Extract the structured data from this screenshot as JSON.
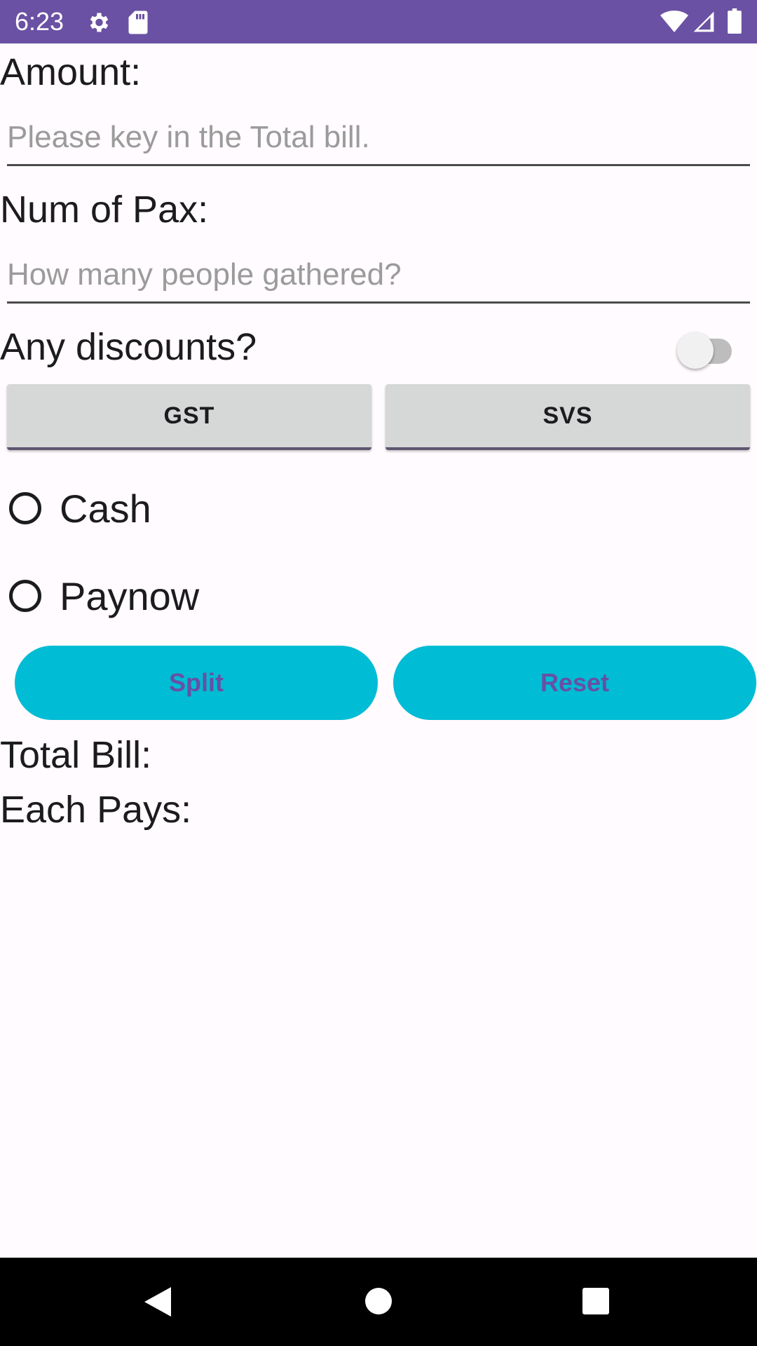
{
  "status_bar": {
    "time": "6:23",
    "icons": [
      "gear-icon",
      "sd-card-icon",
      "wifi-icon",
      "cell-signal-icon",
      "battery-icon"
    ],
    "background": "#6A51A3"
  },
  "form": {
    "amount_label": "Amount:",
    "amount_value": "",
    "amount_placeholder": "Please key in the Total bill.",
    "pax_label": "Num of Pax:",
    "pax_value": "",
    "pax_placeholder": "How many people gathered?",
    "discount_label": "Any discounts?",
    "discount_switch_on": false,
    "gst_button": "GST",
    "svs_button": "SVS",
    "payment_options": [
      {
        "label": "Cash",
        "checked": false
      },
      {
        "label": "Paynow",
        "checked": false
      }
    ],
    "split_button": "Split",
    "reset_button": "Reset"
  },
  "results": {
    "total_bill_label": "Total Bill:",
    "each_pays_label": "Each Pays:"
  },
  "nav_bar": {
    "buttons": [
      "back-icon",
      "home-icon",
      "recents-icon"
    ]
  },
  "colors": {
    "primary": "#6A51A3",
    "accent_button": "#00BCD4",
    "button_text": "#6750A4",
    "background": "#FFFBFE"
  }
}
